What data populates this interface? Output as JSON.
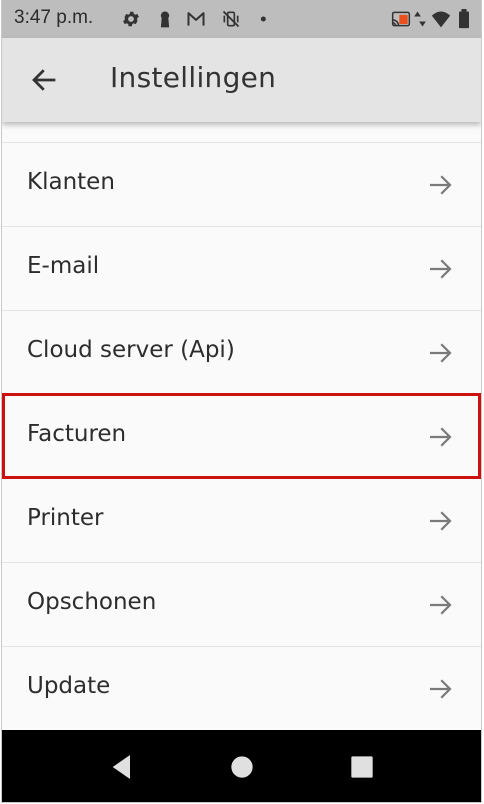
{
  "status_bar": {
    "time": "3:47 p.m.",
    "icons": [
      "gear-icon",
      "keyhole-icon",
      "gmail-icon",
      "vibrate-off-icon",
      "dot-icon",
      "cast-icon",
      "data-arrows-icon",
      "wifi-icon",
      "battery-icon"
    ]
  },
  "app_bar": {
    "title": "Instellingen",
    "back_icon": "arrow-left-icon"
  },
  "settings": {
    "items": [
      {
        "label": "Klanten"
      },
      {
        "label": "E-mail"
      },
      {
        "label": "Cloud server (Api)"
      },
      {
        "label": "Facturen",
        "highlighted": true
      },
      {
        "label": "Printer"
      },
      {
        "label": "Opschonen"
      },
      {
        "label": "Update"
      }
    ],
    "row_icon": "arrow-right-icon"
  },
  "nav_bar": {
    "buttons": [
      "back-triangle-icon",
      "home-circle-icon",
      "recents-square-icon"
    ]
  },
  "colors": {
    "status_bar_bg": "#bdbdbd",
    "app_bar_bg": "#e4e4e4",
    "list_bg": "#fafafa",
    "highlight": "#cc1111",
    "nav_bar_bg": "#000000"
  }
}
